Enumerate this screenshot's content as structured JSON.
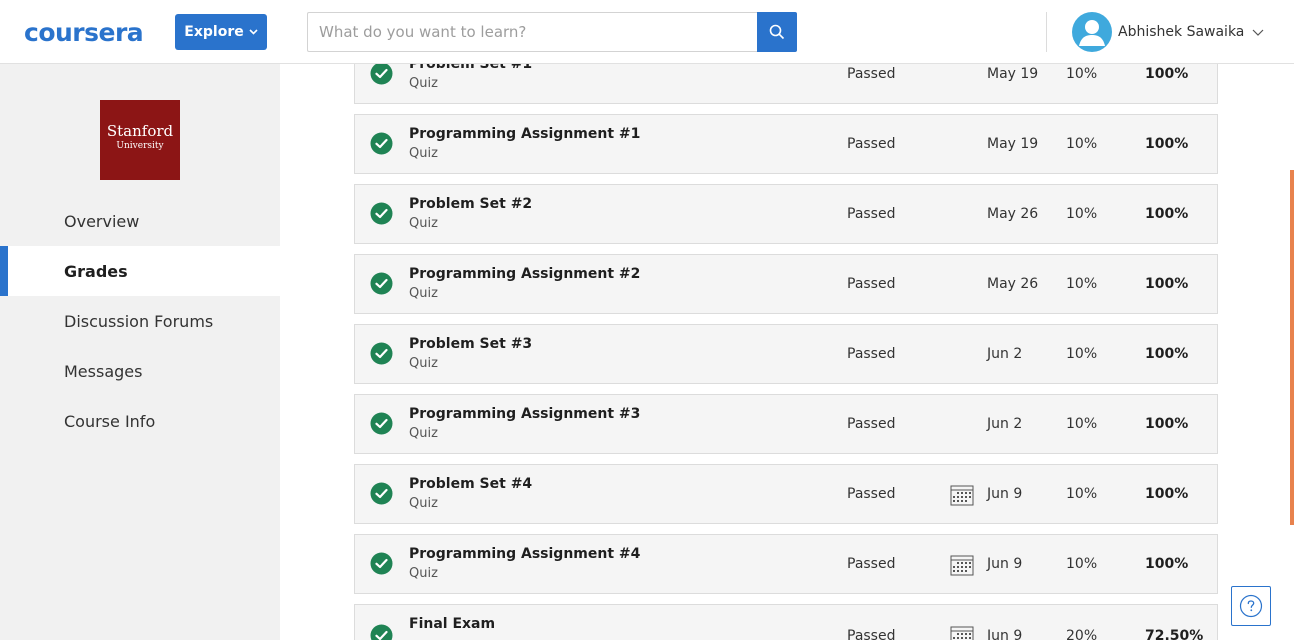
{
  "header": {
    "logo": "coursera",
    "explore_label": "Explore",
    "search_placeholder": "What do you want to learn?",
    "user_name": "Abhishek Sawaika"
  },
  "sidebar": {
    "university": {
      "line1": "Stanford",
      "line2": "University",
      "color": "#8c1515"
    },
    "items": [
      {
        "label": "Overview",
        "active": false
      },
      {
        "label": "Grades",
        "active": true
      },
      {
        "label": "Discussion Forums",
        "active": false
      },
      {
        "label": "Messages",
        "active": false
      },
      {
        "label": "Course Info",
        "active": false
      }
    ]
  },
  "grades": [
    {
      "title": "Problem Set #1",
      "type": "Quiz",
      "status": "Passed",
      "due": "May 19",
      "weight": "10%",
      "grade": "100%",
      "calendar_icon": false
    },
    {
      "title": "Programming Assignment #1",
      "type": "Quiz",
      "status": "Passed",
      "due": "May 19",
      "weight": "10%",
      "grade": "100%",
      "calendar_icon": false
    },
    {
      "title": "Problem Set #2",
      "type": "Quiz",
      "status": "Passed",
      "due": "May 26",
      "weight": "10%",
      "grade": "100%",
      "calendar_icon": false
    },
    {
      "title": "Programming Assignment #2",
      "type": "Quiz",
      "status": "Passed",
      "due": "May 26",
      "weight": "10%",
      "grade": "100%",
      "calendar_icon": false
    },
    {
      "title": "Problem Set #3",
      "type": "Quiz",
      "status": "Passed",
      "due": "Jun 2",
      "weight": "10%",
      "grade": "100%",
      "calendar_icon": false
    },
    {
      "title": "Programming Assignment #3",
      "type": "Quiz",
      "status": "Passed",
      "due": "Jun 2",
      "weight": "10%",
      "grade": "100%",
      "calendar_icon": false
    },
    {
      "title": "Problem Set #4",
      "type": "Quiz",
      "status": "Passed",
      "due": "Jun 9",
      "weight": "10%",
      "grade": "100%",
      "calendar_icon": true
    },
    {
      "title": "Programming Assignment #4",
      "type": "Quiz",
      "status": "Passed",
      "due": "Jun 9",
      "weight": "10%",
      "grade": "100%",
      "calendar_icon": true
    },
    {
      "title": "Final Exam",
      "type": "",
      "status": "Passed",
      "due": "Jun 9",
      "weight": "20%",
      "grade": "72.50%",
      "calendar_icon": true
    }
  ],
  "colors": {
    "brand": "#2a73cc",
    "passed_check": "#1f8354",
    "scroll_accent": "#e8824d"
  }
}
